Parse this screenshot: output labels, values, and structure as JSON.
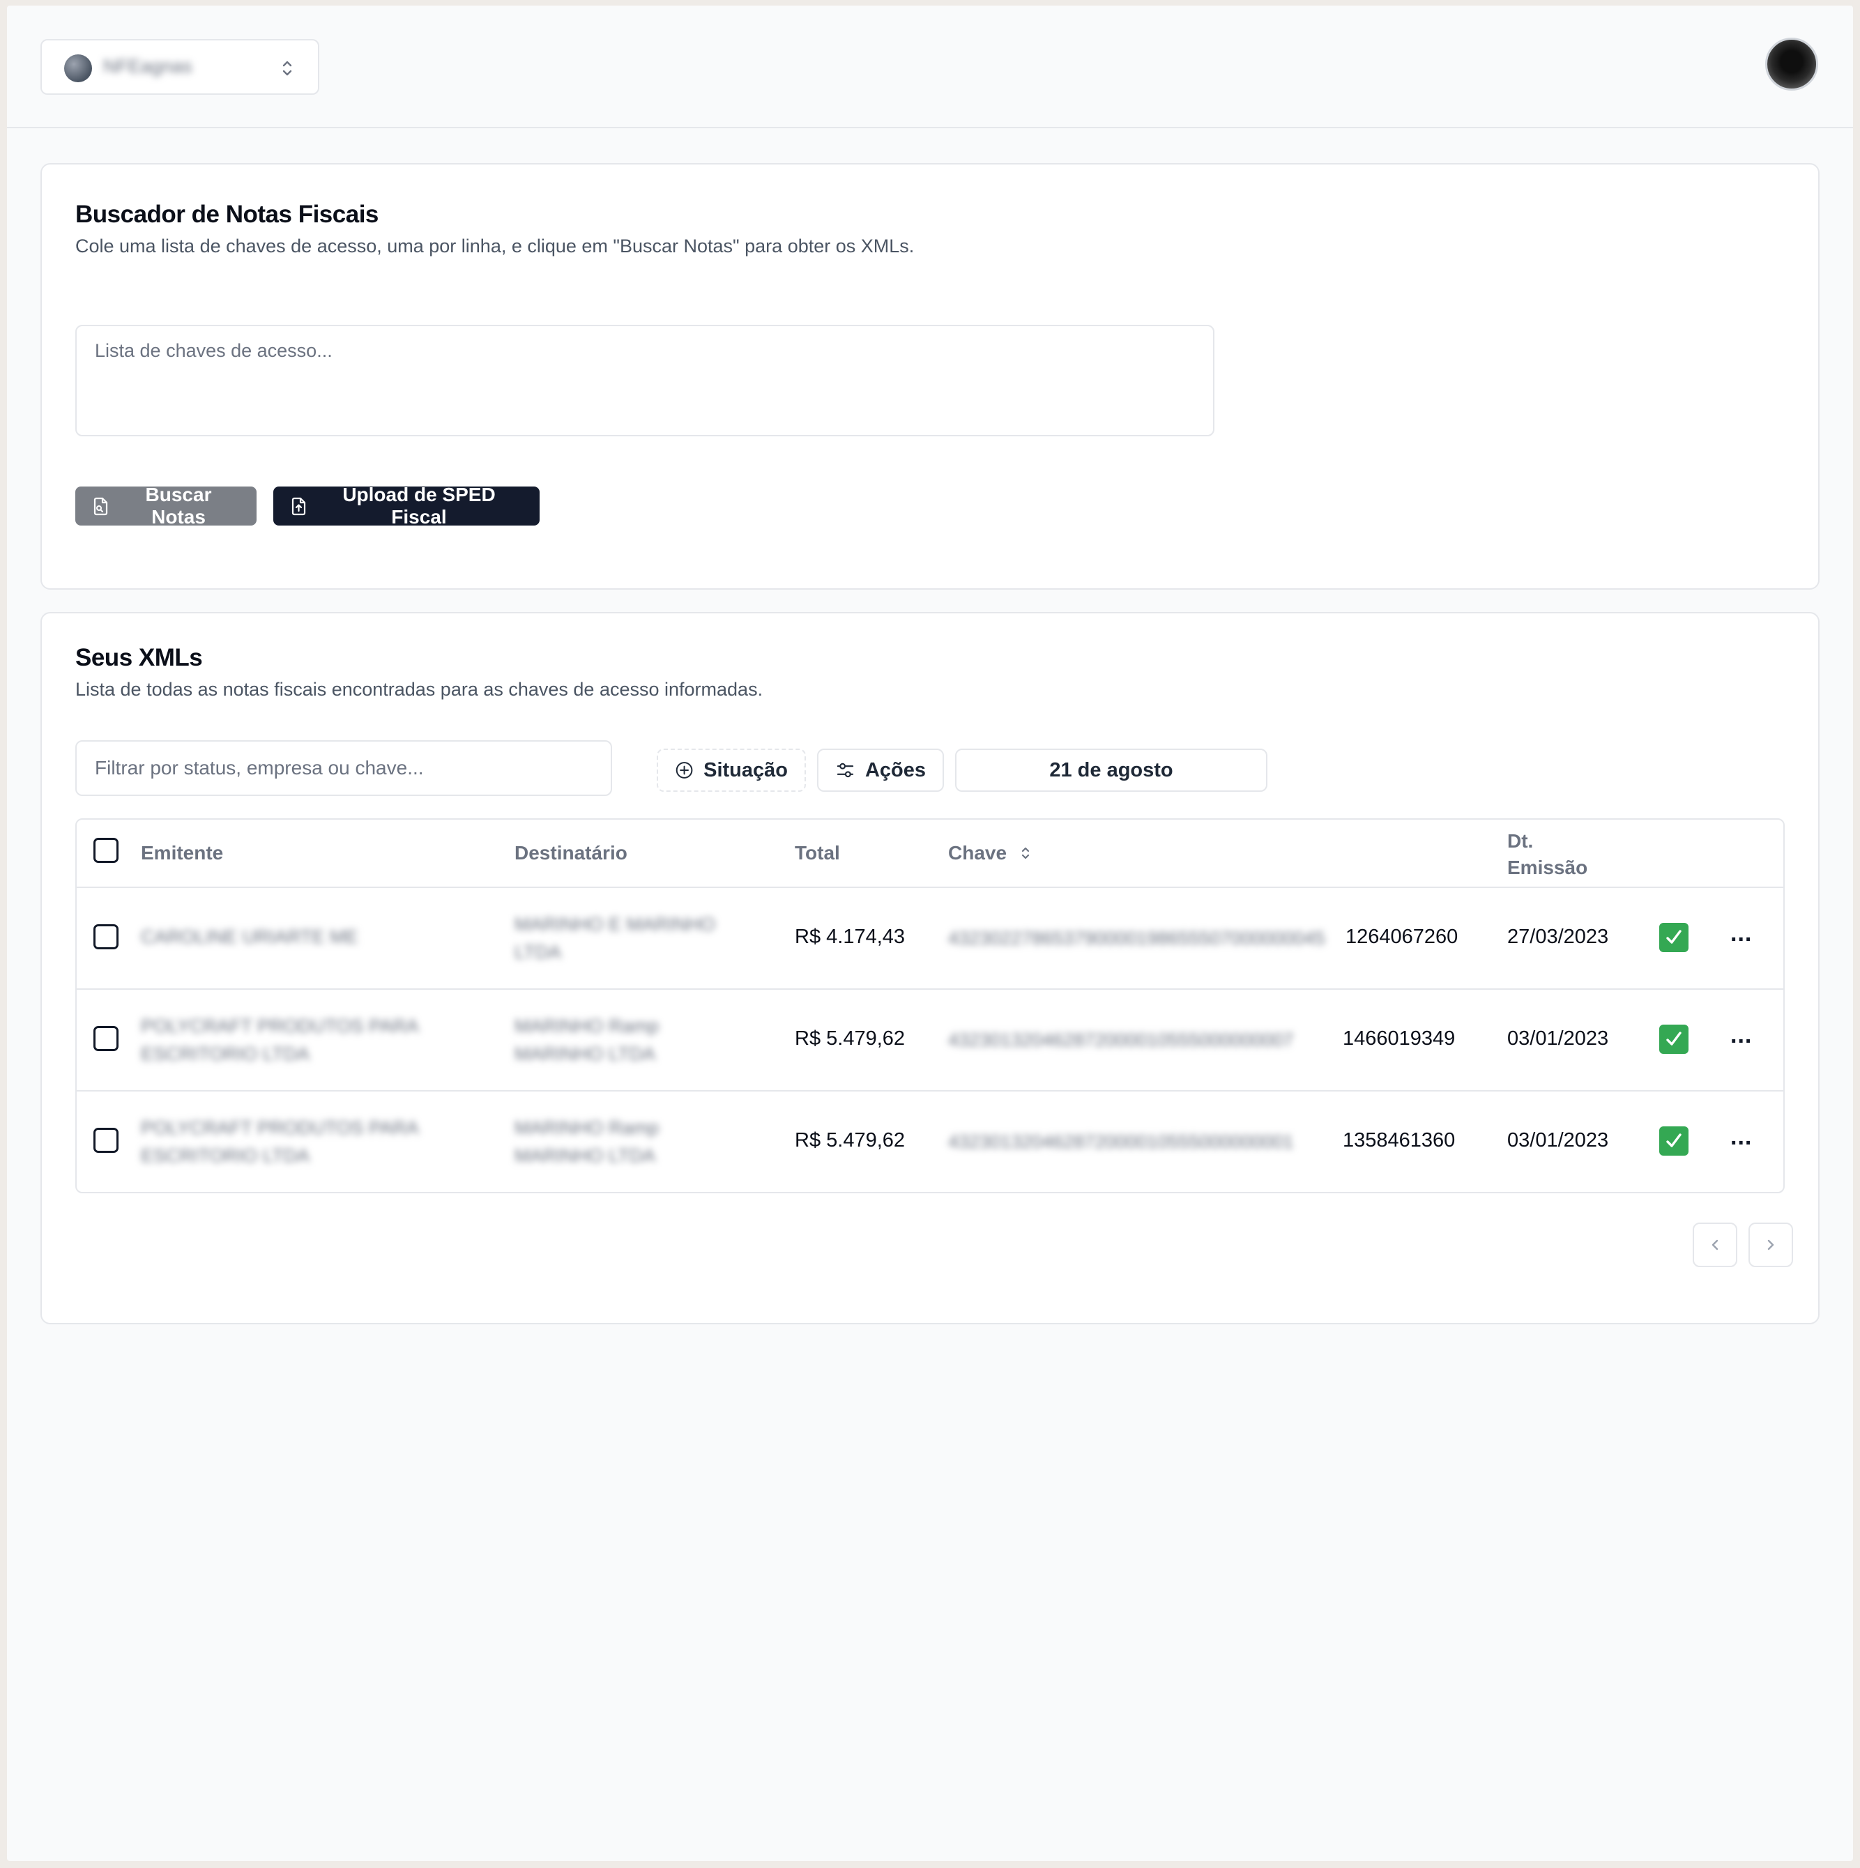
{
  "topbar": {
    "workspace_name": "NFEagnas",
    "chevron_icon": "chevron-up-down-icon",
    "avatar_icon": "user-avatar"
  },
  "search_card": {
    "title": "Buscador de Notas Fiscais",
    "description": "Cole uma lista de chaves de acesso, uma por linha, e clique em \"Buscar Notas\" para obter os XMLs.",
    "textarea_placeholder": "Lista de chaves de acesso...",
    "buscar_label": "Buscar Notas",
    "upload_label": "Upload de SPED Fiscal",
    "colors": {
      "buscar_bg": "#7b7f86",
      "upload_bg": "#141b2d"
    }
  },
  "xml_card": {
    "title": "Seus XMLs",
    "description": "Lista de todas as notas fiscais encontradas para as chaves de acesso informadas.",
    "filter_placeholder": "Filtrar por status, empresa ou chave...",
    "situacao_label": "Situação",
    "acoes_label": "Ações",
    "date_label": "21 de agosto",
    "columns": {
      "emitente": "Emitente",
      "destinatario": "Destinatário",
      "total": "Total",
      "chave": "Chave",
      "dt_line1": "Dt.",
      "dt_line2": "Emissão"
    },
    "rows": [
      {
        "emitente_l1": "CAROLINE URIARTE ME",
        "emitente_l2": "",
        "dest_l1": "MARINHO E MARINHO",
        "dest_l2": "LTDA",
        "total": "R$ 4.174,43",
        "chave_hidden": "432302278653790000198655507000000045",
        "chave_visible": "1264067260",
        "date": "27/03/2023",
        "status_color": "#34a853",
        "more": "..."
      },
      {
        "emitente_l1": "POLYCRAFT PRODUTOS PARA",
        "emitente_l2": "ESCRITORIO LTDA",
        "dest_l1": "MARINHO Ramp",
        "dest_l2": "MARINHO LTDA",
        "total": "R$ 5.479,62",
        "chave_hidden": "432301320462872000010555000000007",
        "chave_visible": "1466019349",
        "date": "03/01/2023",
        "status_color": "#34a853",
        "more": "..."
      },
      {
        "emitente_l1": "POLYCRAFT PRODUTOS PARA",
        "emitente_l2": "ESCRITORIO LTDA",
        "dest_l1": "MARINHO Ramp",
        "dest_l2": "MARINHO LTDA",
        "total": "R$ 5.479,62",
        "chave_hidden": "432301320462872000010555000000001",
        "chave_visible": "1358461360",
        "date": "03/01/2023",
        "status_color": "#34a853",
        "more": "..."
      }
    ],
    "pagination": {
      "prev_icon": "chevron-left-icon",
      "next_icon": "chevron-right-icon"
    }
  }
}
